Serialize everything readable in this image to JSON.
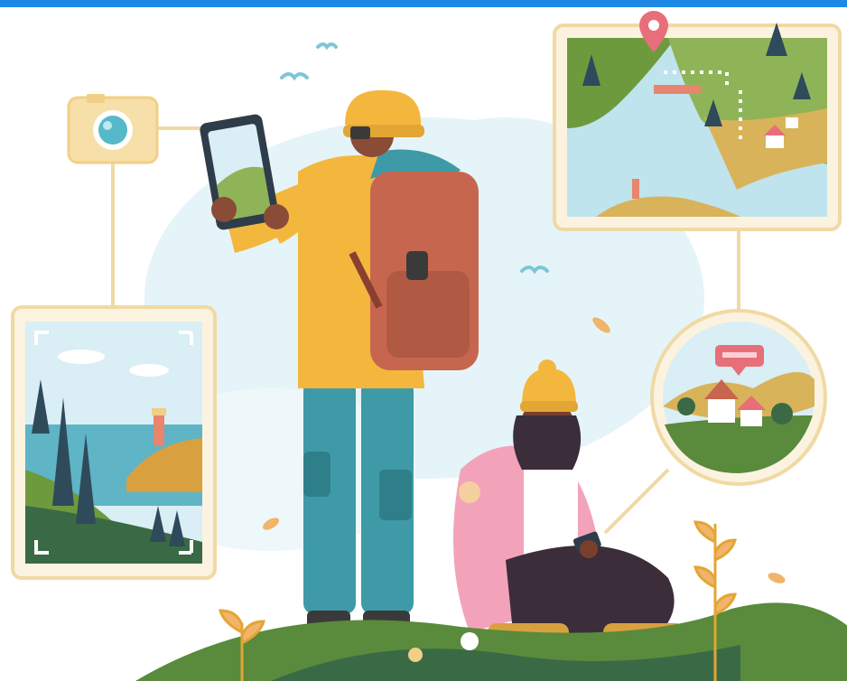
{
  "scene": {
    "description_items": [
      "hiker-with-tablet",
      "hiker-with-phone",
      "camera-icon",
      "photo-frame-coast",
      "map-card",
      "location-pin-icon",
      "circle-view-village"
    ]
  },
  "colors": {
    "top_bar": "#1e88e5",
    "sky_blob": "#dff2f7",
    "frame": "#f4dfae",
    "jacket_yellow": "#f4b73e",
    "backpack": "#c7664e",
    "pants_teal": "#3e9aa7",
    "pink_jacket": "#f3a3b9",
    "hat_yellow": "#f4b73e",
    "grass_green": "#5a8a3c",
    "sea_blue": "#bfe4ee",
    "pin_red": "#e76f7a",
    "tree_dark": "#2f4a5a"
  }
}
